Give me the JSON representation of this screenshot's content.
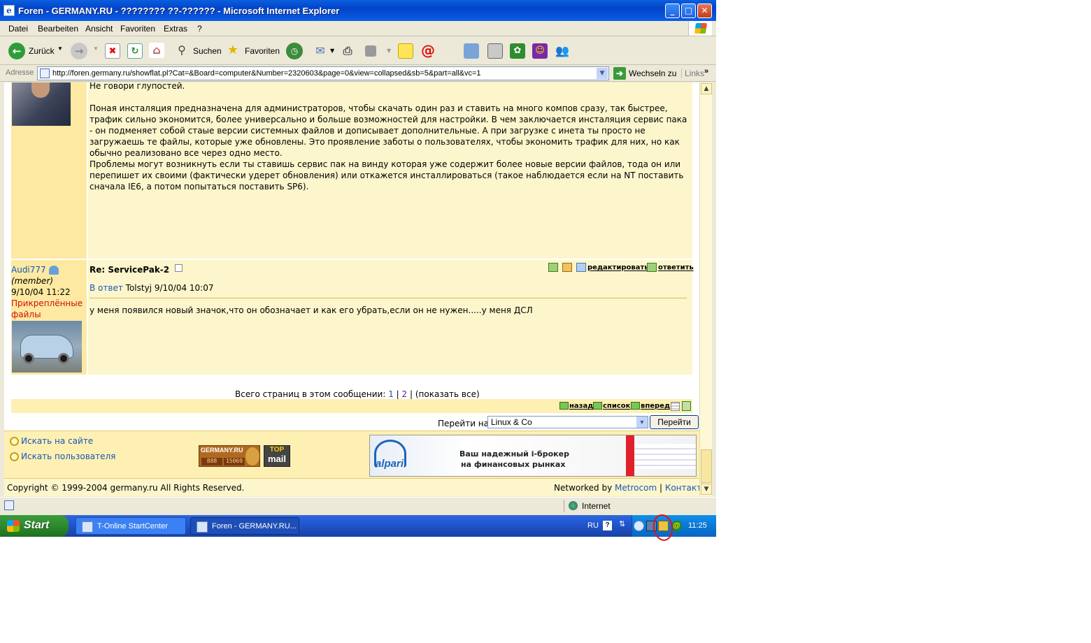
{
  "window": {
    "title": "Foren - GERMANY.RU - ???????? ??-?????? - Microsoft Internet Explorer",
    "buttons": {
      "minimize": "_",
      "maximize": "□",
      "close": "✕"
    }
  },
  "menu": [
    "Datei",
    "Bearbeiten",
    "Ansicht",
    "Favoriten",
    "Extras",
    "?"
  ],
  "toolbar": {
    "back": "Zurück",
    "search": "Suchen",
    "favorites": "Favoriten"
  },
  "address": {
    "label": "Adresse",
    "url": "http://foren.germany.ru/showflat.pl?Cat=&Board=computer&Number=2320603&page=0&view=collapsed&sb=5&part=all&vc=1",
    "go_label": "Wechseln zu",
    "links_label": "Links"
  },
  "post1": {
    "paragraphs": [
      "Не говори глупостей.",
      "Поная инсталяция предназначена для администраторов, чтобы скачать один раз и ставить на много компов сразу, так быстрее, трафик сильно экономится, более универсально и больше возможностей для настройки. В чем заключается инсталяция сервис пака - он подменяет собой стаые версии системных файлов и дописывает дополнительные. А при загрузке с инета ты просто не загружаешь те файлы, которые уже обновлены. Это проявление заботы о пользователях, чтобы экономить трафик для них, но как обычно реализовано все через одно место.",
      "Проблемы могут возникнуть если ты ставишь сервис пак на винду которая уже содержит более новые версии файлов, тода он или перепишет их своими (фактически удерет обновления) или откажется инсталлироваться (такое наблюдается если на NT поставить сначала IE6, а потом попытаться поставить SP6)."
    ]
  },
  "post2": {
    "author": "Audi777",
    "role": "(member)",
    "date": "9/10/04 11:22",
    "attachments": "Прикреплённые файлы",
    "subject": "Re: ServicePak-2",
    "reply_prefix": "В ответ",
    "reply_to": "Tolstyj 9/10/04 10:07",
    "body": "у меня появился новый значок,что он обозначает и как его убрать,если он не нужен.....у меня ДСЛ",
    "actions": {
      "edit": "редактировать",
      "reply": "ответить"
    }
  },
  "pager": {
    "label": "Всего страниц в этом сообщении:",
    "pages": [
      "1",
      "2"
    ],
    "show_all": "(показать все)"
  },
  "nav": {
    "back": "назад",
    "list": "список",
    "forward": "вперед"
  },
  "jump": {
    "label": "Перейти на",
    "selected": "Linux & Co",
    "button": "Перейти"
  },
  "footer": {
    "search_site": "Искать на сайте",
    "search_users": "Искать пользователя",
    "germany_logo": "GERMANY.RU",
    "counters": [
      "888",
      "15069"
    ],
    "topmail": [
      "TOP",
      "mail"
    ],
    "banner": {
      "brand": "alpari",
      "line1": "Ваш надежный i-брокер",
      "line2": "на финансовых рынках"
    },
    "copyright": "Copyright © 1999-2004 germany.ru All Rights Reserved.",
    "networked_by": "Networked by",
    "metrocom": "Metrocom",
    "contact": "Контакт"
  },
  "status": {
    "zone": "Internet"
  },
  "taskbar": {
    "start": "Start",
    "tasks": [
      "T-Online StartCenter",
      "Foren - GERMANY.RU..."
    ],
    "lang": "RU",
    "clock": "11:25"
  },
  "colors": {
    "post_side": "#fde9a1",
    "post_body": "#fdf6cc",
    "link": "#1a56b8",
    "annotation": "#e0101a"
  }
}
